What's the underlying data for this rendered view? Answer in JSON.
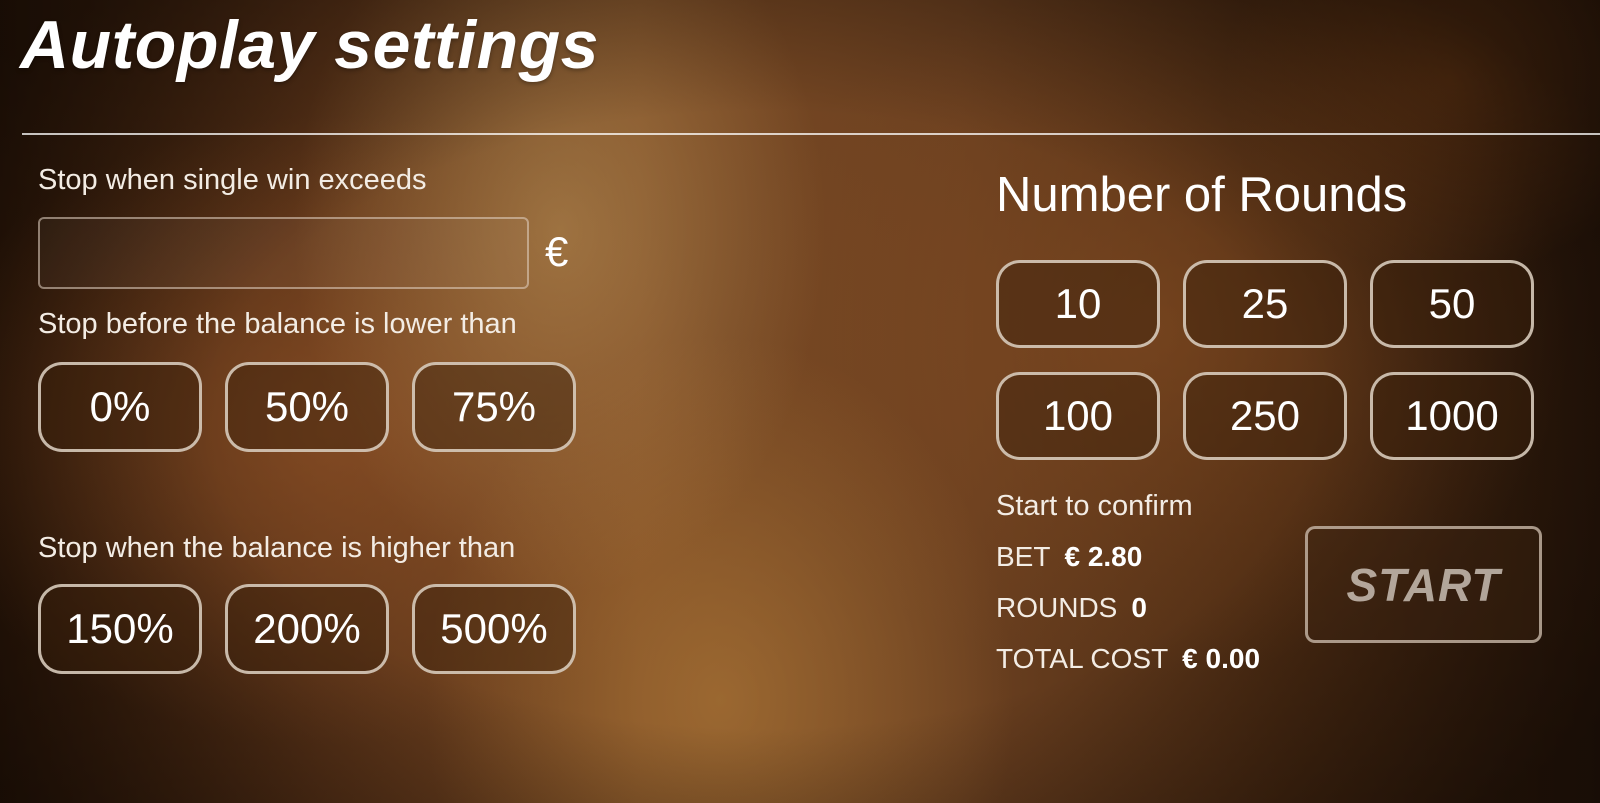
{
  "title": "Autoplay settings",
  "single_win": {
    "label": "Stop when single win exceeds",
    "value": "",
    "currency": "€"
  },
  "loss_limit": {
    "label": "Stop before the balance is lower than",
    "options": [
      "0%",
      "50%",
      "75%"
    ]
  },
  "win_limit": {
    "label": "Stop when the balance is higher than",
    "options": [
      "150%",
      "200%",
      "500%"
    ]
  },
  "rounds": {
    "title": "Number of Rounds",
    "options": [
      "10",
      "25",
      "50",
      "100",
      "250",
      "1000"
    ]
  },
  "summary": {
    "confirm_label": "Start to confirm",
    "bet_label": "BET",
    "bet_value": "€ 2.80",
    "rounds_label": "ROUNDS",
    "rounds_value": "0",
    "total_label": "TOTAL COST",
    "total_value": "€ 0.00"
  },
  "start_label": "START",
  "colors": {
    "text": "#ffffff",
    "pill_border": "#e1d4c6",
    "start_text_disabled": "#d2c8be"
  }
}
